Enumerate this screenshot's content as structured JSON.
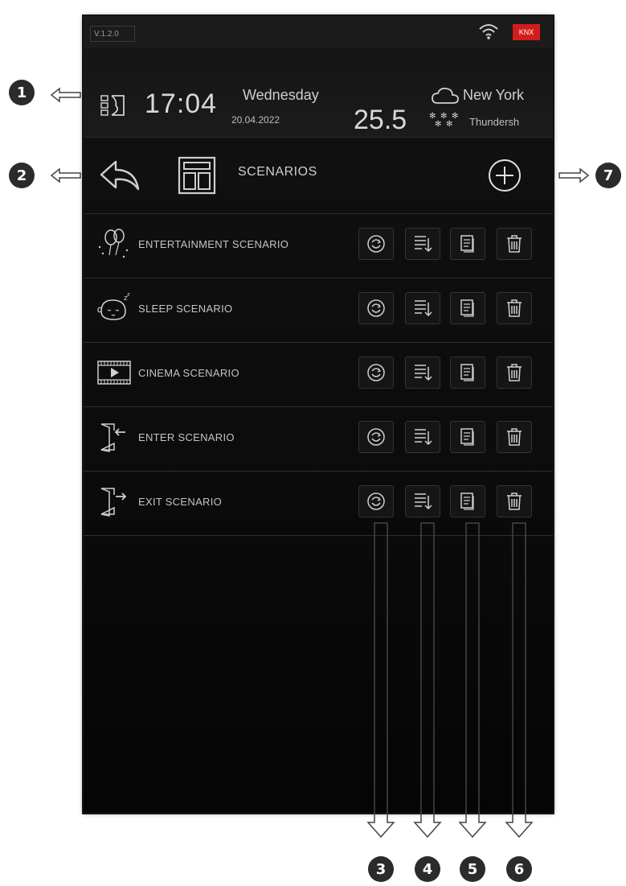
{
  "status_bar": {
    "version": "V.1.2.0",
    "knx_badge": "KNX",
    "wifi_icon": "wifi-icon"
  },
  "header": {
    "time": "17:04",
    "day": "Wednesday",
    "date": "20.04.2022",
    "temperature": "25.5",
    "city": "New York",
    "weather": "Thundersh",
    "weather_icon": "cloud-snow-icon"
  },
  "titlebar": {
    "title": "SCENARIOS"
  },
  "scenarios": [
    {
      "label": "ENTERTAINMENT SCENARIO",
      "icon": "balloons-icon"
    },
    {
      "label": "SLEEP SCENARIO",
      "icon": "sleeping-face-icon"
    },
    {
      "label": "CINEMA SCENARIO",
      "icon": "film-icon"
    },
    {
      "label": "ENTER SCENARIO",
      "icon": "door-enter-icon"
    },
    {
      "label": "EXIT SCENARIO",
      "icon": "door-exit-icon"
    }
  ],
  "row_actions": [
    "run-icon",
    "reorder-icon",
    "copy-icon",
    "delete-icon"
  ],
  "callouts": [
    "1",
    "2",
    "3",
    "4",
    "5",
    "6",
    "7"
  ],
  "colors": {
    "knx_red": "#d21d1d",
    "background": "#0b0b0b",
    "text": "#cfcfcf"
  }
}
